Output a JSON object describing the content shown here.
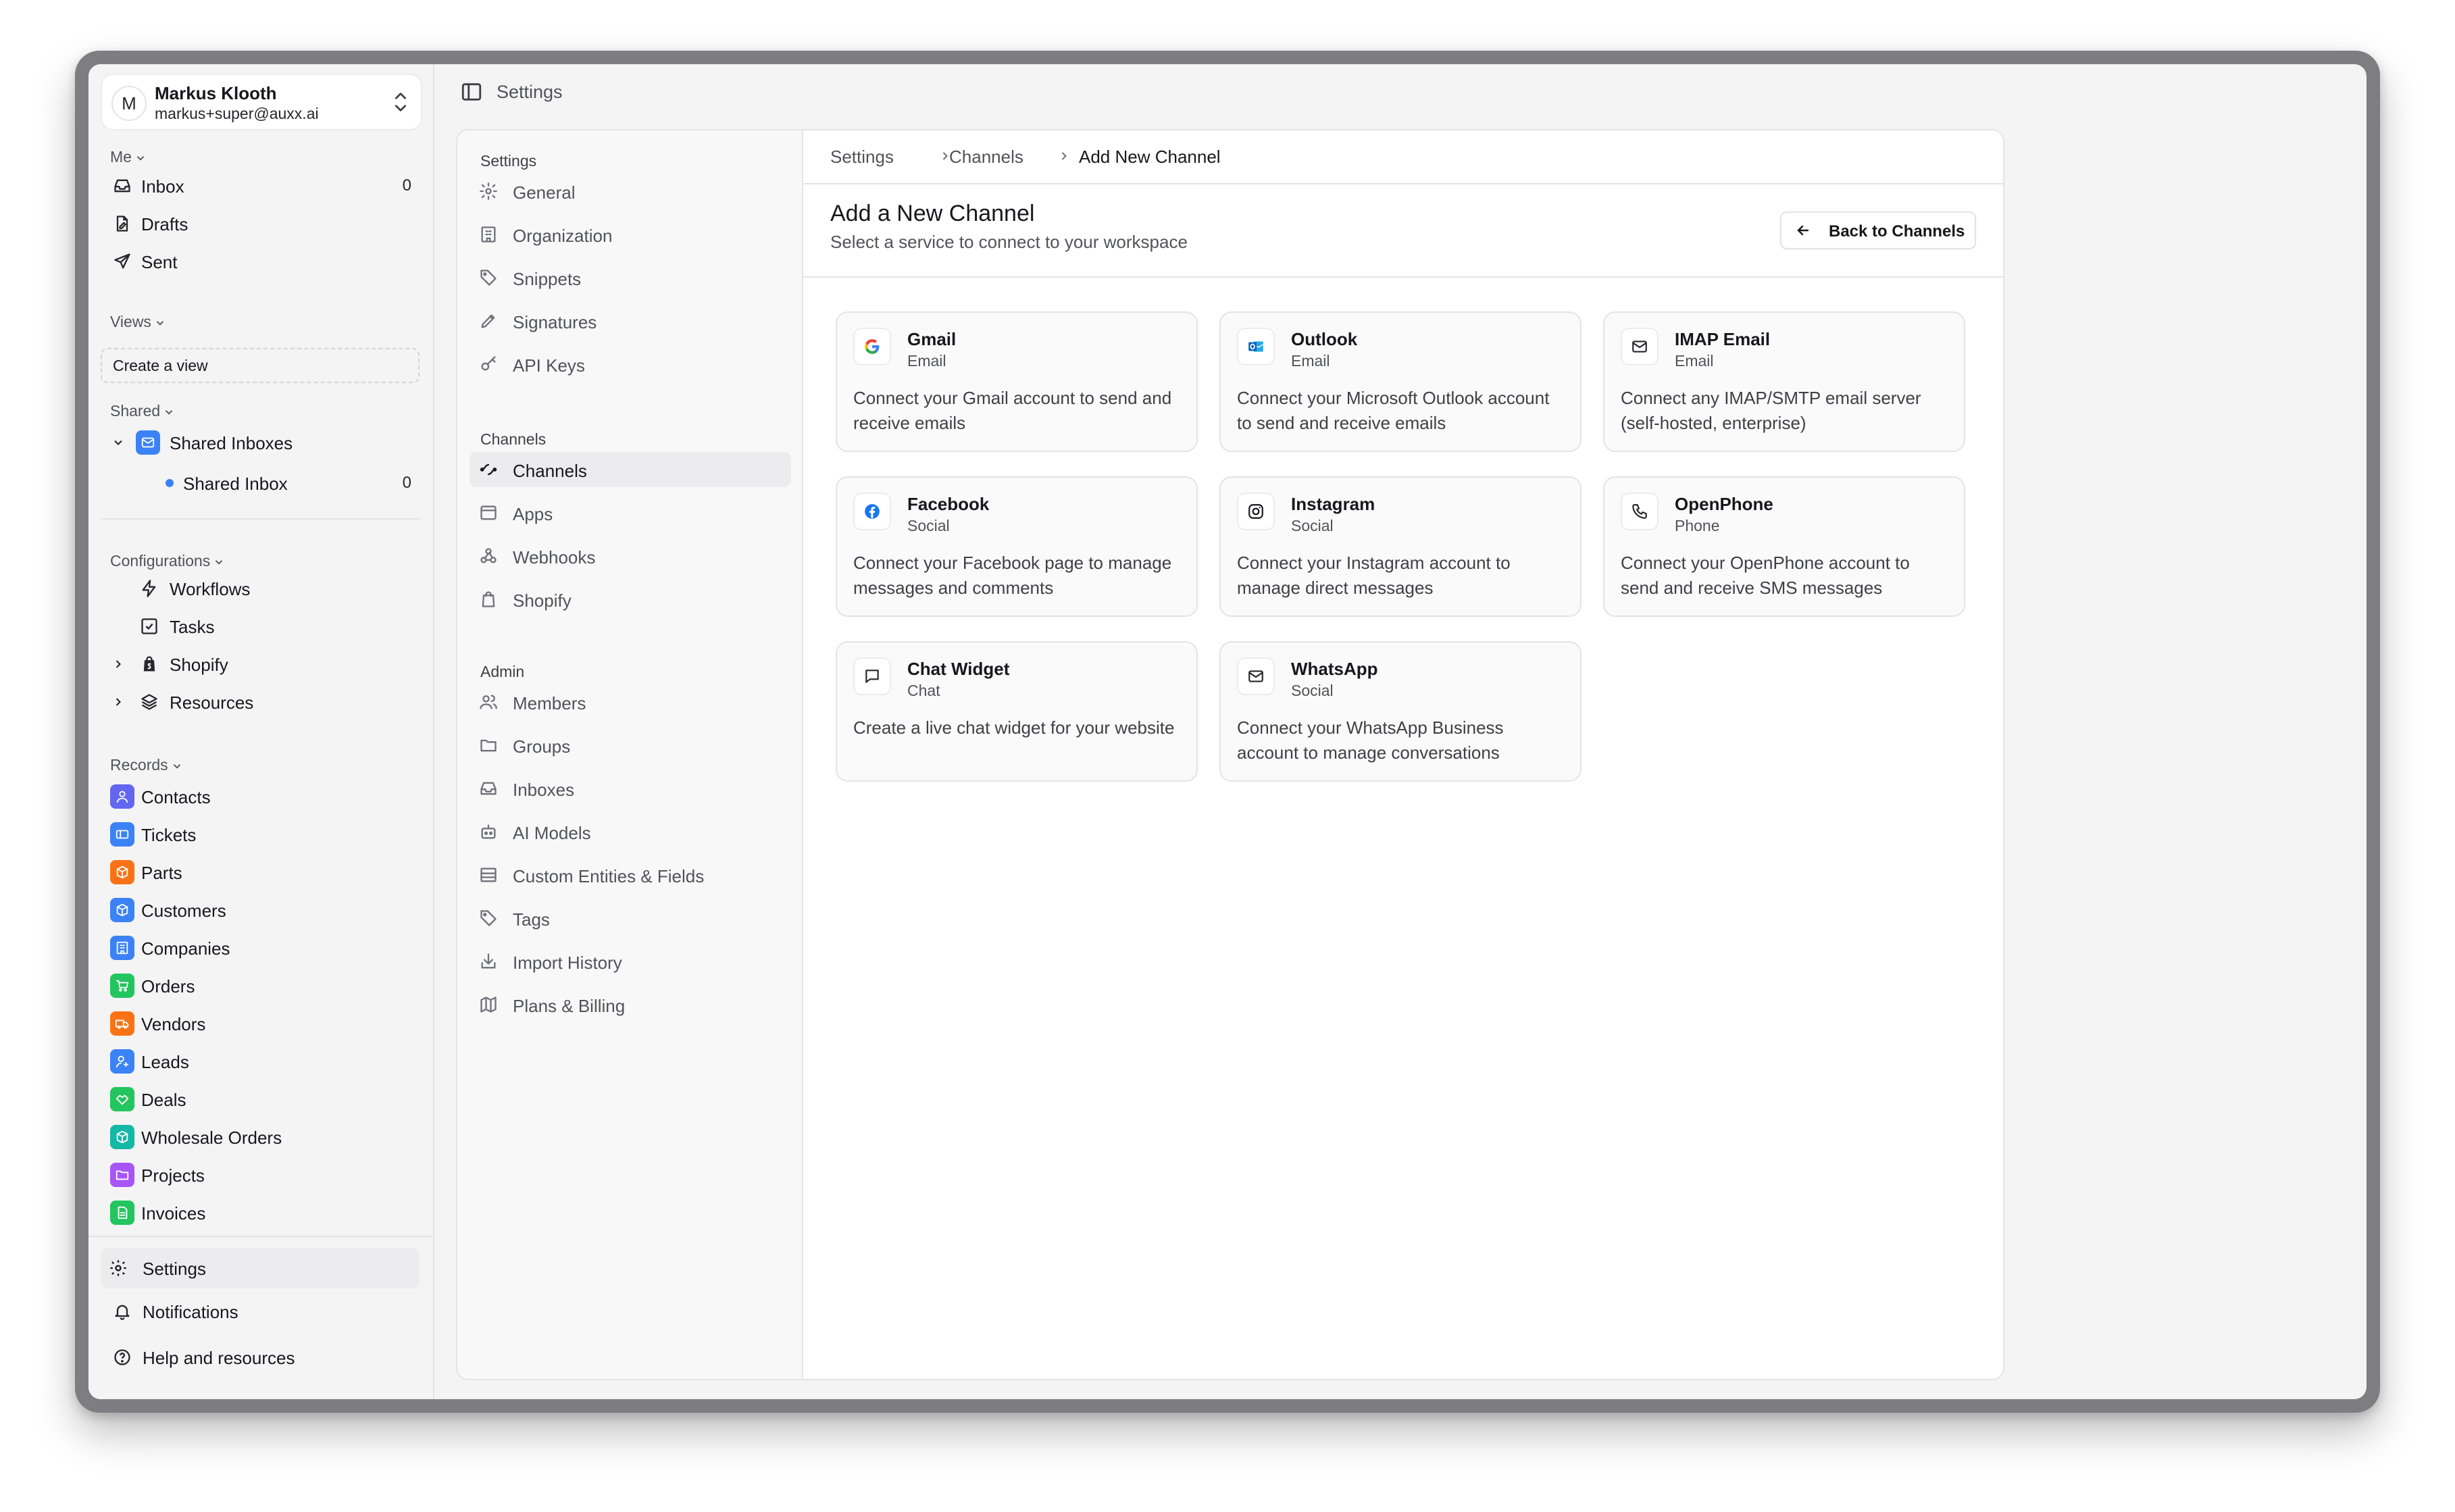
{
  "account": {
    "initial": "M",
    "name": "Markus Klooth",
    "email": "markus+super@auxx.ai"
  },
  "sidebar": {
    "me_label": "Me",
    "me_items": [
      {
        "label": "Inbox",
        "count": "0"
      },
      {
        "label": "Drafts"
      },
      {
        "label": "Sent"
      }
    ],
    "views_label": "Views",
    "create_view": "Create a view",
    "shared_label": "Shared",
    "shared_group": "Shared Inboxes",
    "shared_inbox": {
      "label": "Shared Inbox",
      "count": "0"
    },
    "config_label": "Configurations",
    "config_items": [
      {
        "label": "Workflows"
      },
      {
        "label": "Tasks"
      },
      {
        "label": "Shopify"
      },
      {
        "label": "Resources"
      }
    ],
    "records_label": "Records",
    "records": [
      {
        "label": "Contacts",
        "color": "#6366f1"
      },
      {
        "label": "Tickets",
        "color": "#3b82f6"
      },
      {
        "label": "Parts",
        "color": "#f97316"
      },
      {
        "label": "Customers",
        "color": "#3b82f6"
      },
      {
        "label": "Companies",
        "color": "#3b82f6"
      },
      {
        "label": "Orders",
        "color": "#22c55e"
      },
      {
        "label": "Vendors",
        "color": "#f97316"
      },
      {
        "label": "Leads",
        "color": "#3b82f6"
      },
      {
        "label": "Deals",
        "color": "#22c55e"
      },
      {
        "label": "Wholesale Orders",
        "color": "#14b8a6"
      },
      {
        "label": "Projects",
        "color": "#a855f7"
      },
      {
        "label": "Invoices",
        "color": "#22c55e"
      }
    ],
    "bottom": [
      {
        "label": "Settings"
      },
      {
        "label": "Notifications"
      },
      {
        "label": "Help and resources"
      }
    ]
  },
  "topbar": {
    "title": "Settings"
  },
  "settings_nav": {
    "settings_head": "Settings",
    "settings_items": [
      "General",
      "Organization",
      "Snippets",
      "Signatures",
      "API Keys"
    ],
    "channels_head": "Channels",
    "channels_items": [
      "Channels",
      "Apps",
      "Webhooks",
      "Shopify"
    ],
    "admin_head": "Admin",
    "admin_items": [
      "Members",
      "Groups",
      "Inboxes",
      "AI Models",
      "Custom Entities & Fields",
      "Tags",
      "Import History",
      "Plans & Billing"
    ]
  },
  "breadcrumb": [
    "Settings",
    "Channels",
    "Add New Channel"
  ],
  "page": {
    "title": "Add a New Channel",
    "subtitle": "Select a service to connect to your workspace",
    "back_label": "Back to Channels"
  },
  "channels": [
    {
      "name": "Gmail",
      "category": "Email",
      "desc": "Connect your Gmail account to send and receive emails",
      "icon": "google-icon"
    },
    {
      "name": "Outlook",
      "category": "Email",
      "desc": "Connect your Microsoft Outlook account to send and receive emails",
      "icon": "outlook-icon"
    },
    {
      "name": "IMAP Email",
      "category": "Email",
      "desc": "Connect any IMAP/SMTP email server (self-hosted, enterprise)",
      "icon": "mail-icon"
    },
    {
      "name": "Facebook",
      "category": "Social",
      "desc": "Connect your Facebook page to manage messages and comments",
      "icon": "facebook-icon"
    },
    {
      "name": "Instagram",
      "category": "Social",
      "desc": "Connect your Instagram account to manage direct messages",
      "icon": "instagram-icon"
    },
    {
      "name": "OpenPhone",
      "category": "Phone",
      "desc": "Connect your OpenPhone account to send and receive SMS messages",
      "icon": "phone-icon"
    },
    {
      "name": "Chat Widget",
      "category": "Chat",
      "desc": "Create a live chat widget for your website",
      "icon": "chat-icon"
    },
    {
      "name": "WhatsApp",
      "category": "Social",
      "desc": "Connect your WhatsApp Business account to manage conversations",
      "icon": "mail-icon"
    }
  ]
}
